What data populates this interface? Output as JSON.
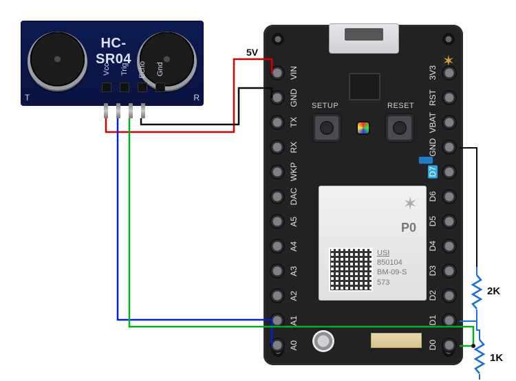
{
  "sensor": {
    "title": "HC-SR04",
    "t_label": "T",
    "r_label": "R",
    "pins": [
      "Vcc",
      "Trig",
      "Echo",
      "Gnd"
    ]
  },
  "board": {
    "name_label": "P0",
    "spark_glyph": "✶",
    "usi_label": "USI",
    "part_number": "850104",
    "model": "BM-09-S",
    "rev": "573",
    "btn_setup": "SETUP",
    "btn_reset": "RESET",
    "left_pins": [
      "VIN",
      "GND",
      "TX",
      "RX",
      "WKP",
      "DAC",
      "A5",
      "A4",
      "A3",
      "A2",
      "A1",
      "A0"
    ],
    "right_pins": [
      "3V3",
      "RST",
      "VBAT",
      "GND",
      "D7",
      "D6",
      "D5",
      "D4",
      "D3",
      "D2",
      "D1",
      "D0"
    ]
  },
  "wires": {
    "five_v_label": "5V",
    "vcc_color": "#d40000",
    "trig_color": "#0022cc",
    "echo_color": "#00b020",
    "gnd_color": "#0a0a0a",
    "res_color": "#1a6fd6"
  },
  "resistors": {
    "r1_label": "2K",
    "r2_label": "1K"
  }
}
